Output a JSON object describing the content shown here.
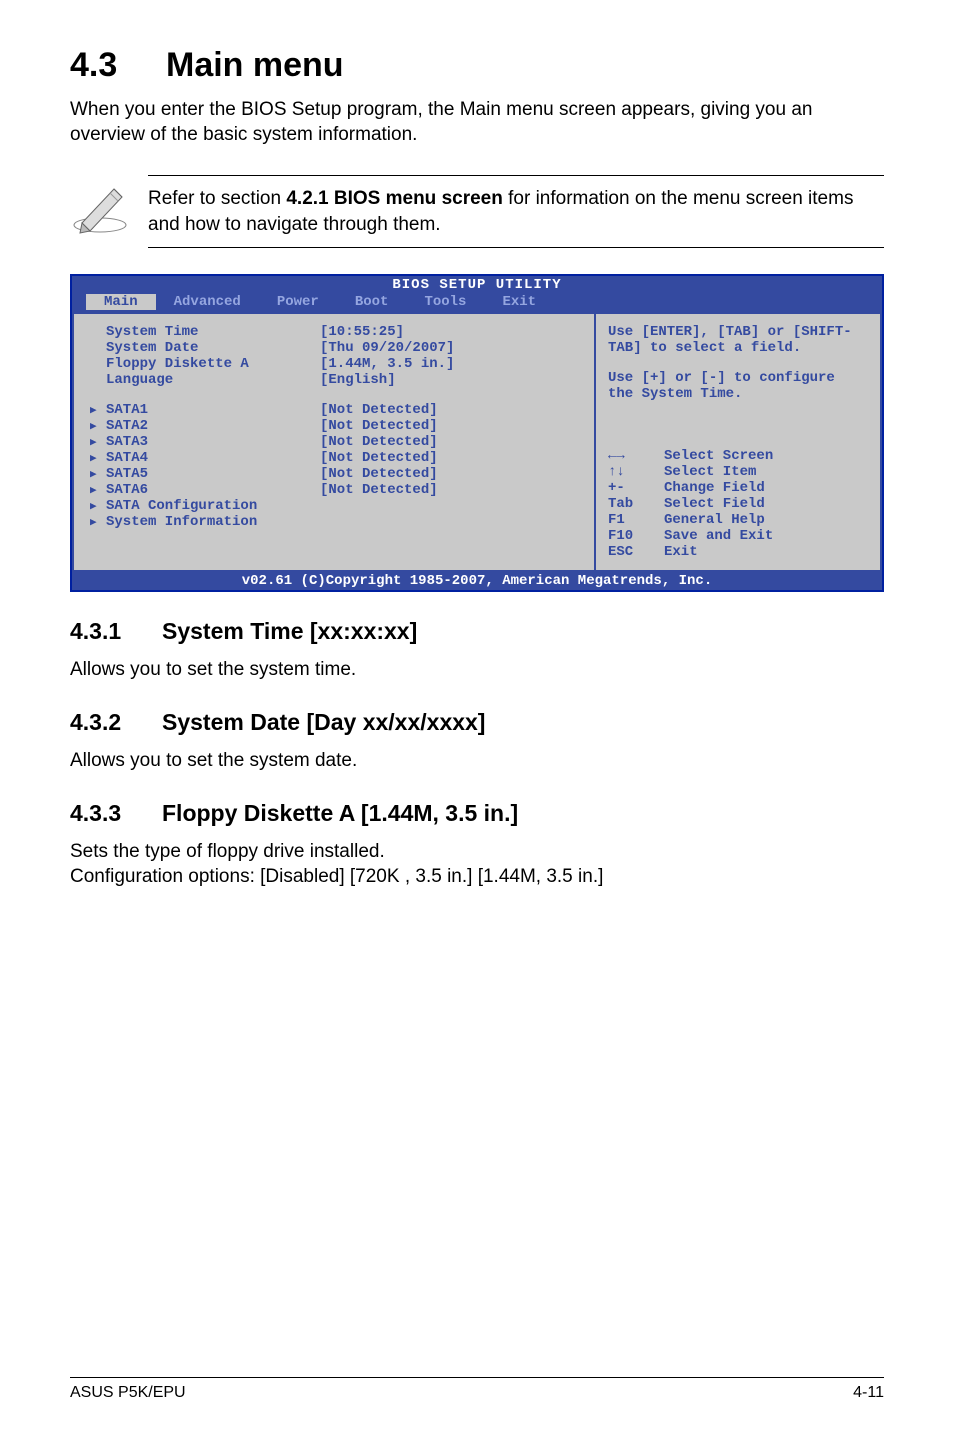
{
  "heading": {
    "num": "4.3",
    "title": "Main menu"
  },
  "intro": "When you enter the BIOS Setup program, the Main menu screen appears, giving you an overview of the basic system information.",
  "note": {
    "pre": "Refer to section ",
    "bold": "4.2.1  BIOS menu screen",
    "post": " for information on the menu screen items and how to navigate through them."
  },
  "bios": {
    "title": "BIOS SETUP UTILITY",
    "tabs": [
      "Main",
      "Advanced",
      "Power",
      "Boot",
      "Tools",
      "Exit"
    ],
    "active_tab": "Main",
    "left_group1": [
      {
        "label": "System Time",
        "value": "[10:55:25]"
      },
      {
        "label": "System Date",
        "value": "[Thu 09/20/2007]"
      },
      {
        "label": "Floppy Diskette A",
        "value": "[1.44M, 3.5 in.]"
      },
      {
        "label": "Language",
        "value": "[English]"
      }
    ],
    "left_group2": [
      {
        "label": "SATA1",
        "value": "[Not Detected]"
      },
      {
        "label": "SATA2",
        "value": "[Not Detected]"
      },
      {
        "label": "SATA3",
        "value": "[Not Detected]"
      },
      {
        "label": "SATA4",
        "value": "[Not Detected]"
      },
      {
        "label": "SATA5",
        "value": "[Not Detected]"
      },
      {
        "label": "SATA6",
        "value": "[Not Detected]"
      }
    ],
    "left_group3": [
      {
        "label": "SATA Configuration"
      },
      {
        "label": "System Information"
      }
    ],
    "help1": "Use [ENTER], [TAB] or [SHIFT-TAB] to select a field.",
    "help2": "Use [+] or [-] to configure the System Time.",
    "keys": [
      {
        "sym": "←→",
        "txt": "Select Screen"
      },
      {
        "sym": "↑↓",
        "txt": "Select Item"
      },
      {
        "sym": "+-",
        "txt": "Change Field"
      },
      {
        "sym": "Tab",
        "txt": "Select Field"
      },
      {
        "sym": "F1",
        "txt": "General Help"
      },
      {
        "sym": "F10",
        "txt": "Save and Exit"
      },
      {
        "sym": "ESC",
        "txt": "Exit"
      }
    ],
    "copyright": "v02.61 (C)Copyright 1985-2007, American Megatrends, Inc."
  },
  "sections": [
    {
      "num": "4.3.1",
      "title": "System Time [xx:xx:xx]",
      "body": "Allows you to set the system time."
    },
    {
      "num": "4.3.2",
      "title": "System Date [Day xx/xx/xxxx]",
      "body": "Allows you to set the system date."
    },
    {
      "num": "4.3.3",
      "title": "Floppy Diskette A [1.44M, 3.5 in.]",
      "body": "Sets the type of floppy drive installed.\nConfiguration options: [Disabled] [720K , 3.5 in.] [1.44M, 3.5 in.]"
    }
  ],
  "footer": {
    "left": "ASUS P5K/EPU",
    "right": "4-11"
  }
}
